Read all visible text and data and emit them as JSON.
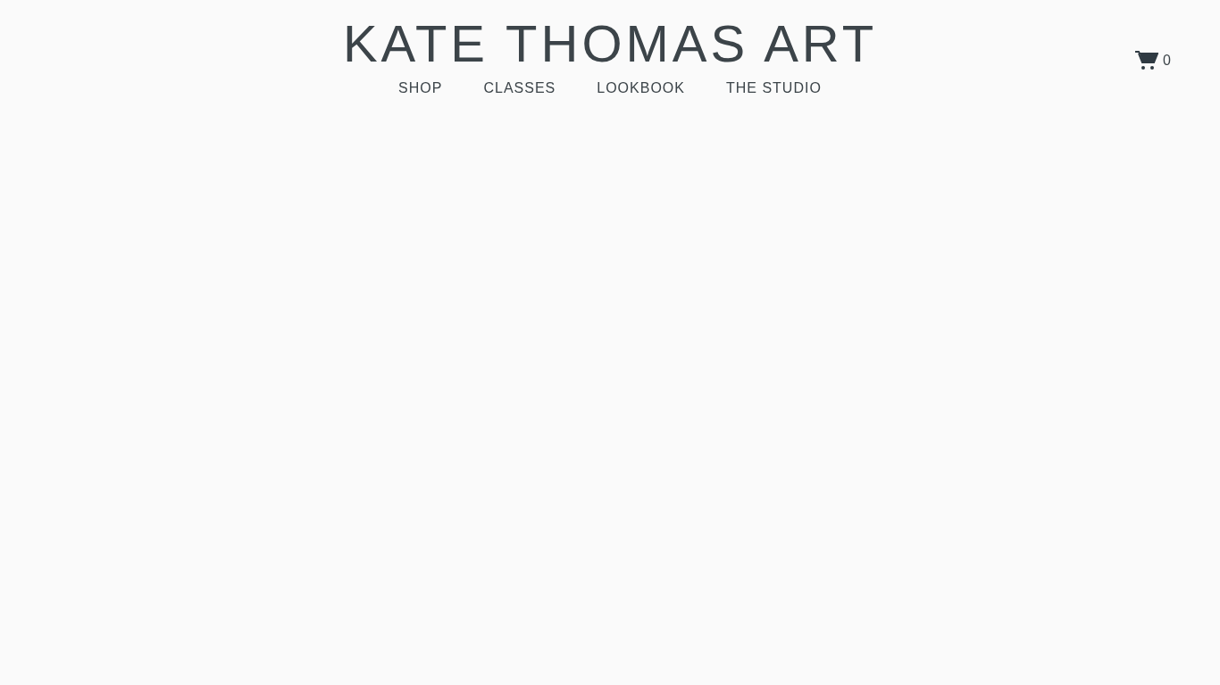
{
  "site_title": "KATE THOMAS ART",
  "nav": [
    {
      "label": "SHOP"
    },
    {
      "label": "CLASSES"
    },
    {
      "label": "LOOKBOOK"
    },
    {
      "label": "THE STUDIO"
    }
  ],
  "cart": {
    "count": "0"
  }
}
